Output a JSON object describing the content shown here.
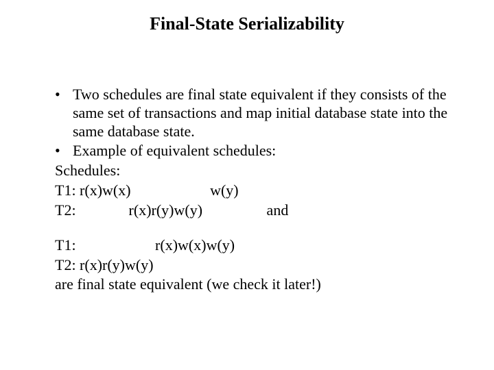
{
  "title": "Final-State Serializability",
  "body": {
    "b1": "Two schedules are final state equivalent if they consists of the same set of transactions and map initial database state into the same database state.",
    "b2": "Example of equivalent schedules:",
    "schedules_label": "Schedules:",
    "row1": "T1: r(x)w(x)                     w(y)",
    "row2": "T2:              r(x)r(y)w(y)                 and",
    "row3": "T1:                     r(x)w(x)w(y)",
    "row4": "T2: r(x)r(y)w(y)",
    "closing": "are final state equivalent (we check it later!)"
  }
}
